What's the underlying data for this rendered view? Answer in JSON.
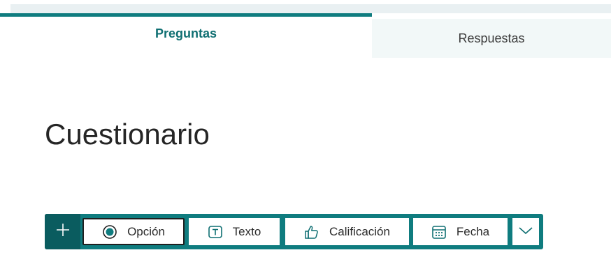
{
  "tabs": {
    "questions": "Preguntas",
    "responses": "Respuestas"
  },
  "form": {
    "title": "Cuestionario"
  },
  "toolbar": {
    "add_icon": "plus-icon",
    "buttons": [
      {
        "label": "Opción",
        "icon": "radio-button-icon"
      },
      {
        "label": "Texto",
        "icon": "text-box-icon"
      },
      {
        "label": "Calificación",
        "icon": "thumbs-up-icon"
      },
      {
        "label": "Fecha",
        "icon": "calendar-icon"
      }
    ],
    "more_icon": "chevron-down-icon"
  },
  "colors": {
    "accent": "#0f7c7f",
    "accent_dark": "#0a5c5f",
    "tab_inactive_bg": "#f2f8f8"
  }
}
